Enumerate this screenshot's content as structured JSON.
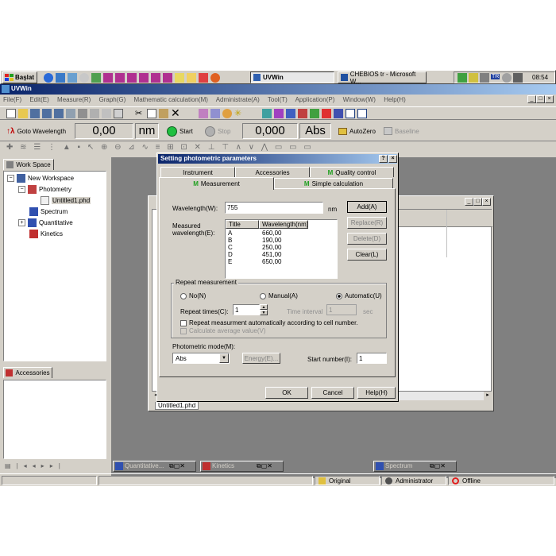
{
  "taskbar": {
    "start_label": "Başlat",
    "tasks": [
      {
        "label": "UVWin"
      },
      {
        "label": "CHEBIOS tr - Microsoft W..."
      }
    ],
    "tray_lang": "TR",
    "clock": "08:54"
  },
  "app": {
    "title": "UVWin",
    "menu": [
      "File(F)",
      "Edit(E)",
      "Measure(R)",
      "Graph(G)",
      "Mathematic calculation(M)",
      "Administrate(A)",
      "Tool(T)",
      "Application(P)",
      "Window(W)",
      "Help(H)"
    ]
  },
  "measure_bar": {
    "goto_label": "Goto Wavelength",
    "wavelength_value": "0,00",
    "wavelength_unit": "nm",
    "start_label": "Start",
    "stop_label": "Stop",
    "abs_value": "0,000",
    "abs_unit": "Abs",
    "autozero_label": "AutoZero",
    "baseline_label": "Baseline"
  },
  "workspace": {
    "tab_label": "Work Space",
    "tree": {
      "root": "New Workspace",
      "photometry": "Photometry",
      "file": "Untitled1.phd",
      "spectrum": "Spectrum",
      "quantitative": "Quantitative",
      "kinetics": "Kinetics"
    }
  },
  "accessories_panel": {
    "tab_label": "Accessories"
  },
  "background_window": {
    "tab_label": "Untitled1.phd"
  },
  "minimized_windows": [
    "Quantitative...",
    "Kinetics",
    "Spectrum"
  ],
  "statusbar": {
    "original": "Original",
    "user": "Administrator",
    "state": "Offline"
  },
  "dialog": {
    "title": "Setting photometric parameters",
    "tabs_back": [
      "Instrument",
      "Accessories",
      "Quality control"
    ],
    "tabs_front": [
      "Measurement",
      "Simple calculation"
    ],
    "wavelength_label": "Wavelength(W):",
    "wavelength_value": "755",
    "wavelength_unit": "nm",
    "measured_label_1": "Measured",
    "measured_label_2": "wavelength(E):",
    "list_headers": [
      "Title",
      "Wavelength(nm)"
    ],
    "list_rows": [
      {
        "title": "A",
        "wavelength": "660,00"
      },
      {
        "title": "B",
        "wavelength": "190,00"
      },
      {
        "title": "C",
        "wavelength": "250,00"
      },
      {
        "title": "D",
        "wavelength": "451,00"
      },
      {
        "title": "E",
        "wavelength": "650,00"
      }
    ],
    "add_label": "Add(A)",
    "replace_label": "Replace(R)",
    "delete_label": "Delete(D)",
    "clear_label": "Clear(L)",
    "repeat_group": "Repeat measurement",
    "radio_no": "No(N)",
    "radio_manual": "Manual(A)",
    "radio_automatic": "Automatic(U)",
    "repeat_times_label": "Repeat times(C):",
    "repeat_times_value": "1",
    "time_interval_label": "Time interval",
    "time_interval_value": "1",
    "time_interval_unit": "sec",
    "check_auto": "Repeat measurment automatically according to cell number.",
    "check_avg": "Calculate average value(V)",
    "mode_label": "Photometric mode(M):",
    "mode_value": "Abs",
    "energy_label": "Energy(E)...",
    "start_number_label": "Start number(I):",
    "start_number_value": "1",
    "ok_label": "OK",
    "cancel_label": "Cancel",
    "help_label": "Help(H)"
  }
}
